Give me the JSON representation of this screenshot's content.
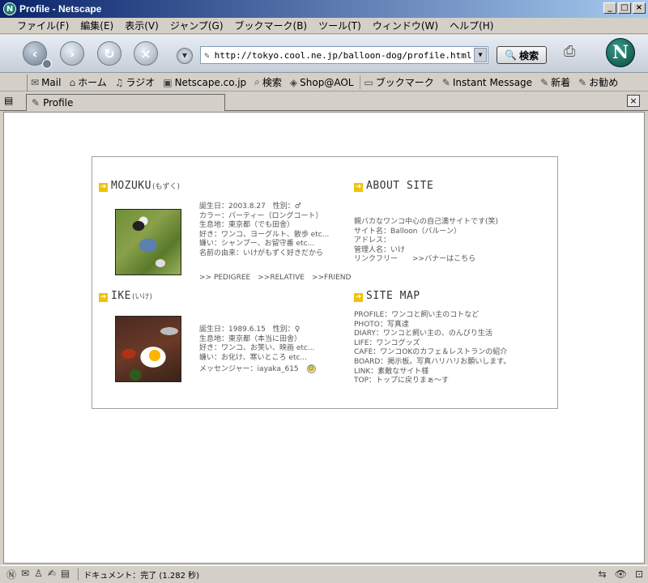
{
  "window": {
    "title": "Profile - Netscape",
    "app_icon": "N"
  },
  "menu": [
    "ファイル(F)",
    "編集(E)",
    "表示(V)",
    "ジャンプ(G)",
    "ブックマーク(B)",
    "ツール(T)",
    "ウィンドウ(W)",
    "ヘルプ(H)"
  ],
  "nav": {
    "url": "http://tokyo.cool.ne.jp/balloon-dog/profile.html",
    "search_label": "検索",
    "logo_letter": "N"
  },
  "personal_toolbar": [
    {
      "icon": "mail-icon",
      "label": "Mail"
    },
    {
      "icon": "home-icon",
      "label": "ホーム"
    },
    {
      "icon": "radio-icon",
      "label": "ラジオ"
    },
    {
      "icon": "netscape-icon",
      "label": "Netscape.co.jp"
    },
    {
      "icon": "search-icon",
      "label": "検索"
    },
    {
      "icon": "aol-icon",
      "label": "Shop@AOL"
    },
    {
      "icon": "folder-icon",
      "label": "ブックマーク"
    },
    {
      "icon": "link-icon",
      "label": "Instant Message"
    },
    {
      "icon": "link-icon",
      "label": "新着"
    },
    {
      "icon": "link-icon",
      "label": "お勧め"
    }
  ],
  "tab": {
    "label": "Profile"
  },
  "page": {
    "mozuku": {
      "title": "MOZUKU",
      "sub": "(もずく)",
      "lines": [
        "誕生日：2003.8.27　性別：♂",
        "カラー：パーティー（ロングコート）",
        "生息地：東京都（でも田舎）",
        "好き：ワンコ、ヨーグルト、散歩 etc...",
        "嫌い：シャンプー、お留守番 etc...",
        "名前の由来：いけがもずく好きだから"
      ],
      "links": [
        ">> PEDIGREE",
        ">>RELATIVE",
        ">>FRIEND"
      ]
    },
    "ike": {
      "title": "IKE",
      "sub": "(いけ)",
      "lines": [
        "誕生日：1989.6.15　性別：♀",
        "生息地：東京都（本当に田舎）",
        "好き：ワンコ、お笑い、映画 etc...",
        "嫌い：お化け、寒いところ etc..."
      ],
      "messenger": "メッセンジャー：iayaka_615"
    },
    "about": {
      "title": "ABOUT SITE",
      "lines": [
        "親バカなワンコ中心の自己満サイトです(笑)",
        "サイト名：Balloon（バルーン）",
        "アドレス：",
        "管理人名：いけ"
      ],
      "link_free": "リンクフリー　　>>バナーはこちら"
    },
    "sitemap": {
      "title": "SITE MAP",
      "lines": [
        "PROFILE：ワンコと飼い主のコトなど",
        "PHOTO：写真達",
        "DIARY：ワンコと飼い主の、のんびり生活",
        "LIFE：ワンコグッズ",
        "CAFE：ワンコOKのカフェ＆レストランの紹介",
        "BOARD：掲示板。写真ハリハリお願いします。",
        "LINK：素敵なサイト様",
        "TOP：トップに戻りまぁ～す"
      ]
    }
  },
  "status": {
    "text": "ドキュメント：完了 (1.282 秒)"
  }
}
